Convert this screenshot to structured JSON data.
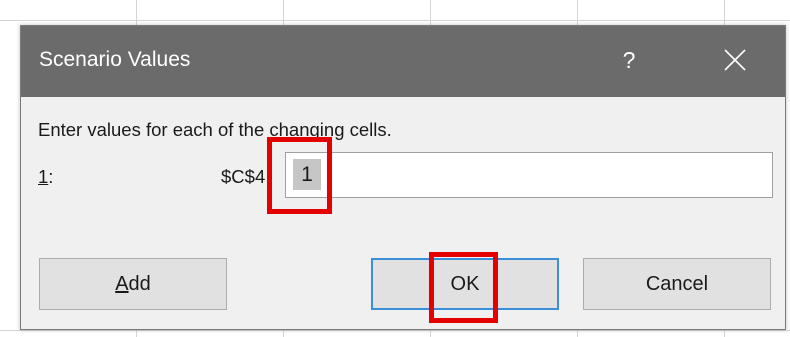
{
  "dialog": {
    "title": "Scenario Values",
    "help_label": "?",
    "close_icon": "close-icon",
    "prompt": "Enter values for each of the changing cells.",
    "rows": [
      {
        "index_label": "1",
        "suffix": ":",
        "cell_ref": "$C$4",
        "value": "1"
      }
    ],
    "buttons": {
      "add_prefix": "",
      "add_accel": "A",
      "add_rest": "dd",
      "ok": "OK",
      "cancel": "Cancel"
    }
  },
  "colors": {
    "titlebar": "#6b6b6b",
    "dialog_bg": "#f0f0f0",
    "highlight": "#e50000",
    "default_button_border": "#3b8fd9"
  }
}
